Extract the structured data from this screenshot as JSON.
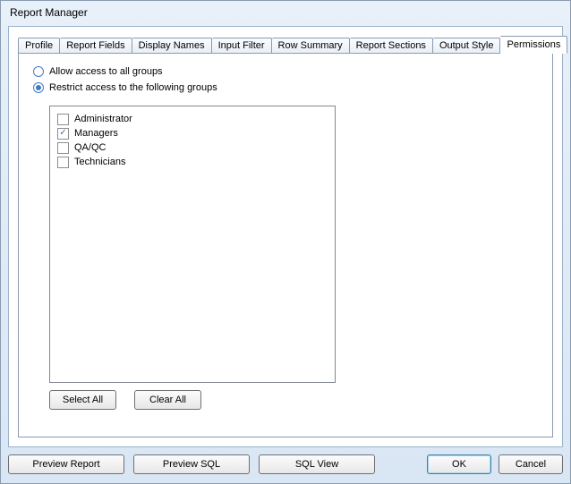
{
  "window": {
    "title": "Report Manager"
  },
  "tabs": [
    {
      "label": "Profile"
    },
    {
      "label": "Report Fields"
    },
    {
      "label": "Display Names"
    },
    {
      "label": "Input Filter"
    },
    {
      "label": "Row Summary"
    },
    {
      "label": "Report Sections"
    },
    {
      "label": "Output Style"
    },
    {
      "label": "Permissions",
      "active": true
    }
  ],
  "permissions": {
    "radio_allow": "Allow access to all groups",
    "radio_restrict": "Restrict access to the following groups",
    "selected": "restrict",
    "groups": [
      {
        "label": "Administrator",
        "checked": false
      },
      {
        "label": "Managers",
        "checked": true
      },
      {
        "label": "QA/QC",
        "checked": false
      },
      {
        "label": "Technicians",
        "checked": false
      }
    ],
    "select_all": "Select All",
    "clear_all": "Clear All"
  },
  "buttons": {
    "preview_report": "Preview Report",
    "preview_sql": "Preview SQL",
    "sql_view": "SQL View",
    "ok": "OK",
    "cancel": "Cancel"
  }
}
